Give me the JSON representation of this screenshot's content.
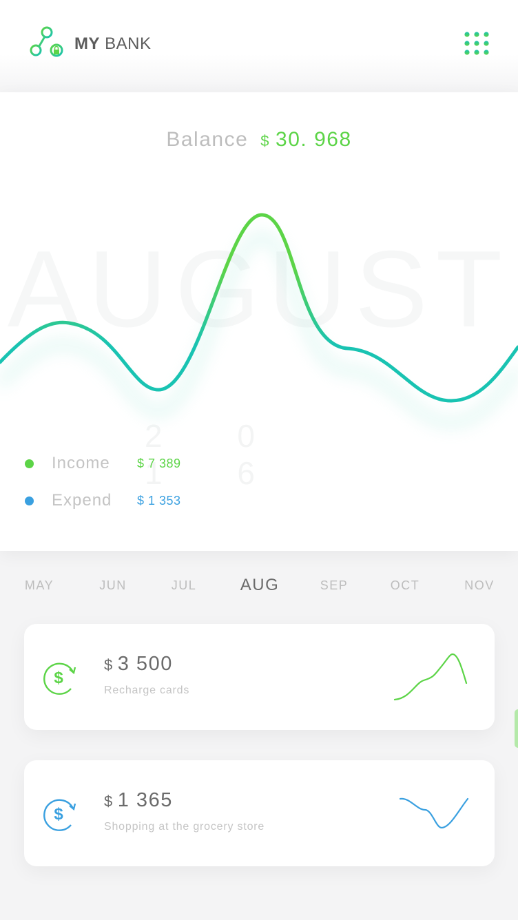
{
  "app": {
    "title_bold": "MY",
    "title_rest": " BANK"
  },
  "icons": {
    "logo": "connected-nodes-lock-icon",
    "menu": "grid-dots-menu-icon",
    "tx": "dollar-refresh-icon"
  },
  "colors": {
    "green": "#5cd447",
    "blue": "#3aa0e0",
    "teal": "#19c3b2"
  },
  "balance": {
    "label": "Balance",
    "currency": "$",
    "value": "30. 968"
  },
  "chart_bg": {
    "month": "AUGUST",
    "year": "2 0 1 6"
  },
  "legend": [
    {
      "label": "Income",
      "value": "$ 7 389",
      "color": "#5cd447"
    },
    {
      "label": "Expend",
      "value": "$ 1 353",
      "color": "#3aa0e0"
    }
  ],
  "months": [
    "MAY",
    "JUN",
    "JUL",
    "AUG",
    "SEP",
    "OCT",
    "NOV"
  ],
  "active_month": "AUG",
  "transactions": [
    {
      "currency": "$",
      "amount": "3 500",
      "description": "Recharge cards",
      "color": "#5cd447"
    },
    {
      "currency": "$",
      "amount": "1 365",
      "description": "Shopping at the grocery store",
      "color": "#3aa0e0"
    }
  ]
}
